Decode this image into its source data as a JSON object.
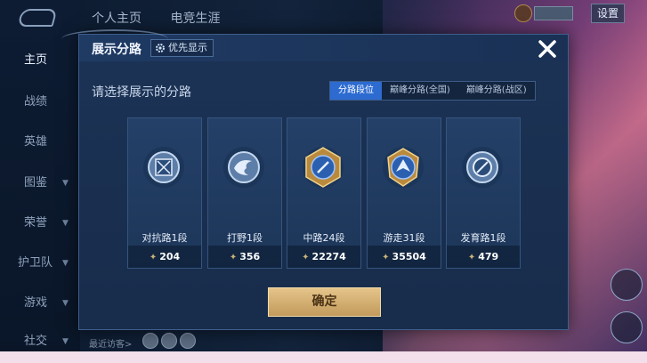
{
  "background": {
    "nav_items": [
      {
        "label": "主页",
        "caret": ""
      },
      {
        "label": "战绩",
        "caret": ""
      },
      {
        "label": "英雄",
        "caret": ""
      },
      {
        "label": "图鉴",
        "caret": "▼"
      },
      {
        "label": "荣誉",
        "caret": "▼"
      },
      {
        "label": "护卫队",
        "caret": "▼"
      },
      {
        "label": "游戏",
        "caret": "▼"
      },
      {
        "label": "社交",
        "caret": "▼"
      }
    ],
    "top_tabs": [
      "个人主页",
      "电竞生涯"
    ],
    "settings_label": "设置",
    "recent_label": "最近访客>"
  },
  "modal": {
    "title": "展示分路",
    "priority_label": "优先显示",
    "close_icon": "close-icon",
    "subtitle": "请选择展示的分路",
    "tabs": [
      "分路段位",
      "巅峰分路(全国)",
      "巅峰分路(战区)"
    ],
    "active_tab": 0,
    "cards": [
      {
        "lane": "对抗路1段",
        "score": "204",
        "icon": "clash-lane-icon"
      },
      {
        "lane": "打野1段",
        "score": "356",
        "icon": "jungle-icon"
      },
      {
        "lane": "中路24段",
        "score": "22274",
        "icon": "mid-lane-icon"
      },
      {
        "lane": "游走31段",
        "score": "35504",
        "icon": "roam-icon"
      },
      {
        "lane": "发育路1段",
        "score": "479",
        "icon": "farm-lane-icon"
      }
    ],
    "confirm_label": "确定"
  },
  "colors": {
    "accent_blue": "#2d6bd1",
    "confirm_gold": "#d4b070",
    "modal_bg": "#1c3356"
  }
}
